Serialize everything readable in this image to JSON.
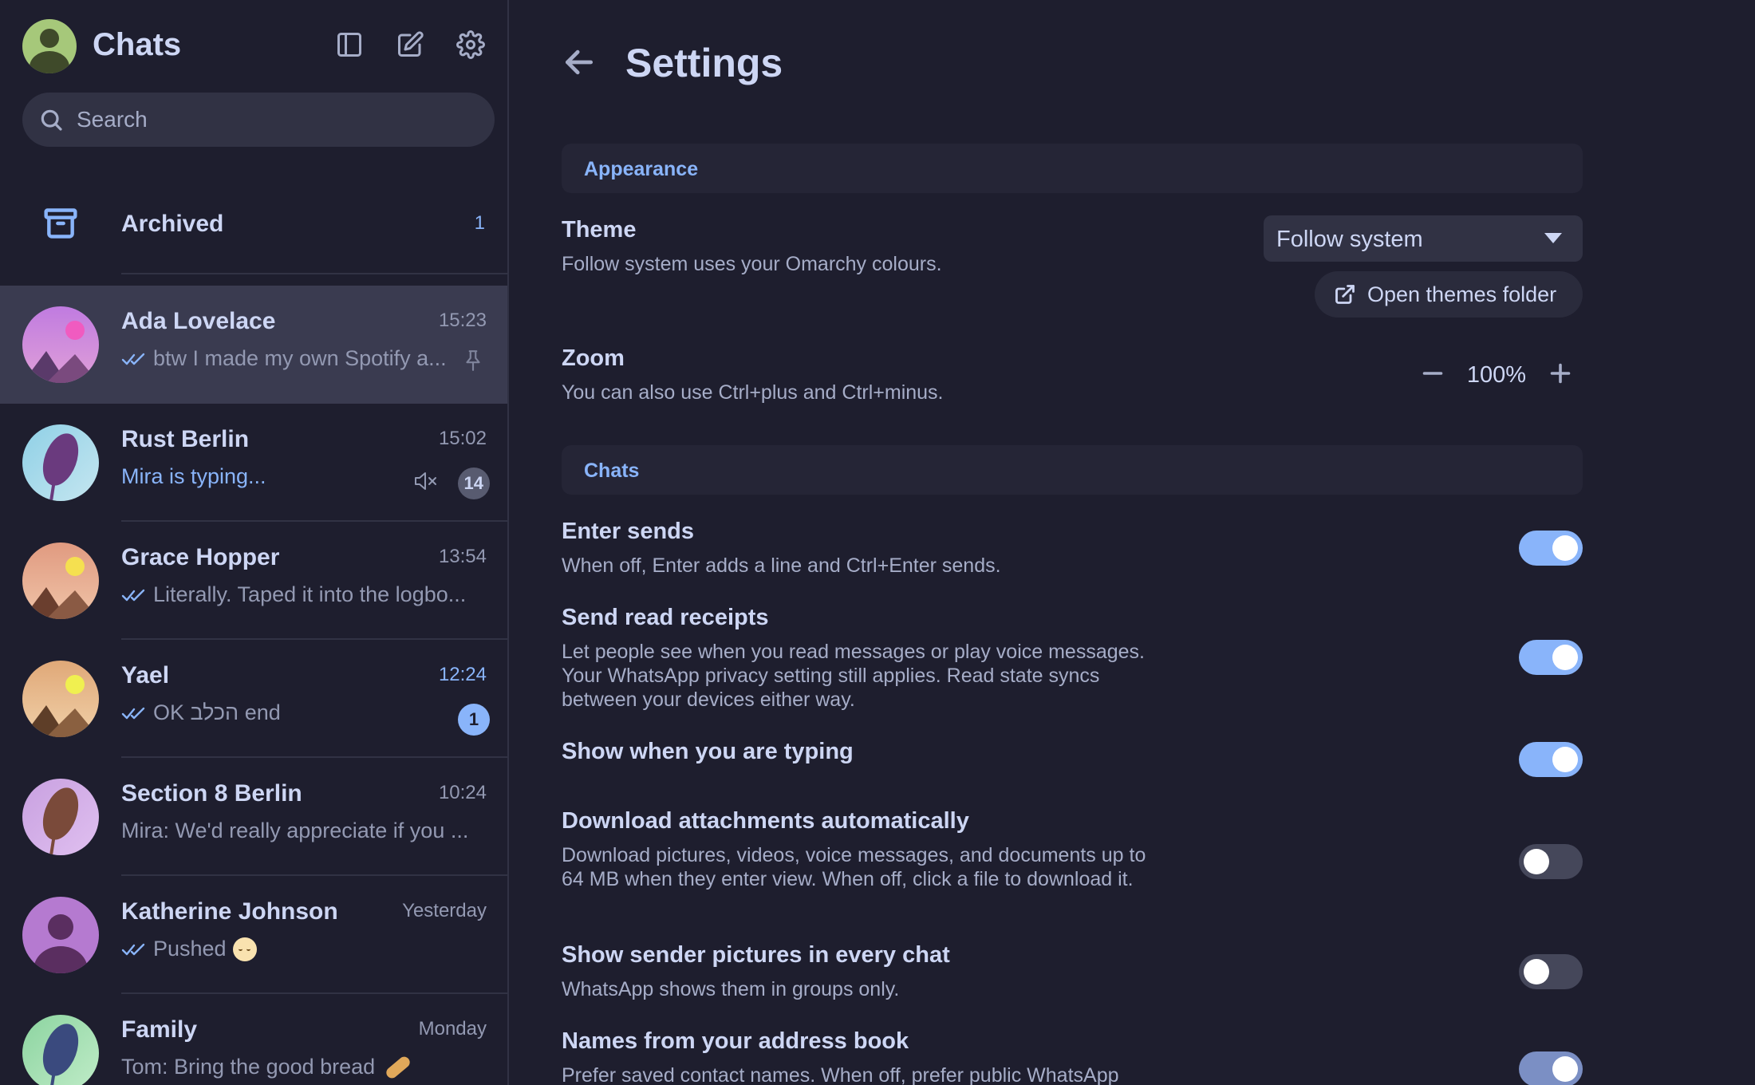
{
  "sidebar": {
    "title": "Chats",
    "search_placeholder": "Search",
    "archived": {
      "label": "Archived",
      "count": "1"
    },
    "chats": [
      {
        "name": "Ada Lovelace",
        "time": "15:23",
        "preview": "btw I made my own Spotify a...",
        "read": true,
        "pinned": true,
        "active": true,
        "avatar": "landscape-pink"
      },
      {
        "name": "Rust Berlin",
        "time": "15:02",
        "preview": "Mira is typing...",
        "typing": true,
        "muted": true,
        "unread": "14",
        "avatar": "leaf-blue"
      },
      {
        "name": "Grace Hopper",
        "time": "13:54",
        "preview": "Literally. Taped it into the logbo...",
        "read": true,
        "avatar": "landscape-orange"
      },
      {
        "name": "Yael",
        "time": "12:24",
        "time_accent": true,
        "preview": "OK הכלב end",
        "read": true,
        "unread": "1",
        "unread_accent": true,
        "avatar": "landscape-tan"
      },
      {
        "name": "Section 8 Berlin",
        "time": "10:24",
        "preview": "Mira: We'd really appreciate if you ...",
        "avatar": "leaf-violet"
      },
      {
        "name": "Katherine Johnson",
        "time": "Yesterday",
        "preview": "Pushed",
        "read": true,
        "emoji": "relieved-face",
        "avatar": "person-violet"
      },
      {
        "name": "Family",
        "time": "Monday",
        "preview": "Tom: Bring the good bread",
        "emoji": "baguette",
        "avatar": "leaf-green"
      }
    ]
  },
  "settings": {
    "title": "Settings",
    "sections": {
      "appearance": "Appearance",
      "chats": "Chats"
    },
    "theme": {
      "title": "Theme",
      "desc": "Follow system uses your Omarchy colours.",
      "value": "Follow system",
      "open_folder": "Open themes folder"
    },
    "zoom": {
      "title": "Zoom",
      "desc": "You can also use Ctrl+plus and Ctrl+minus.",
      "value": "100%"
    },
    "items": [
      {
        "title": "Enter sends",
        "desc": "When off, Enter adds a line and Ctrl+Enter sends.",
        "on": true
      },
      {
        "title": "Send read receipts",
        "desc": "Let people see when you read messages or play voice messages. Your WhatsApp privacy setting still applies. Read state syncs between your devices either way.",
        "on": true
      },
      {
        "title": "Show when you are typing",
        "desc": "",
        "on": true
      },
      {
        "title": "Download attachments automatically",
        "desc": "Download pictures, videos, voice messages, and documents up to 64 MB when they enter view. When off, click a file to download it.",
        "on": false
      },
      {
        "title": "Show sender pictures in every chat",
        "desc": "WhatsApp shows them in groups only.",
        "on": false
      },
      {
        "title": "Names from your address book",
        "desc": "Prefer saved contact names. When off, prefer public WhatsApp",
        "on": true
      }
    ]
  },
  "colors": {
    "background": "#1e1e2e",
    "accent": "#89b4fa",
    "surface": "#313244",
    "text": "#cdd6f4"
  }
}
